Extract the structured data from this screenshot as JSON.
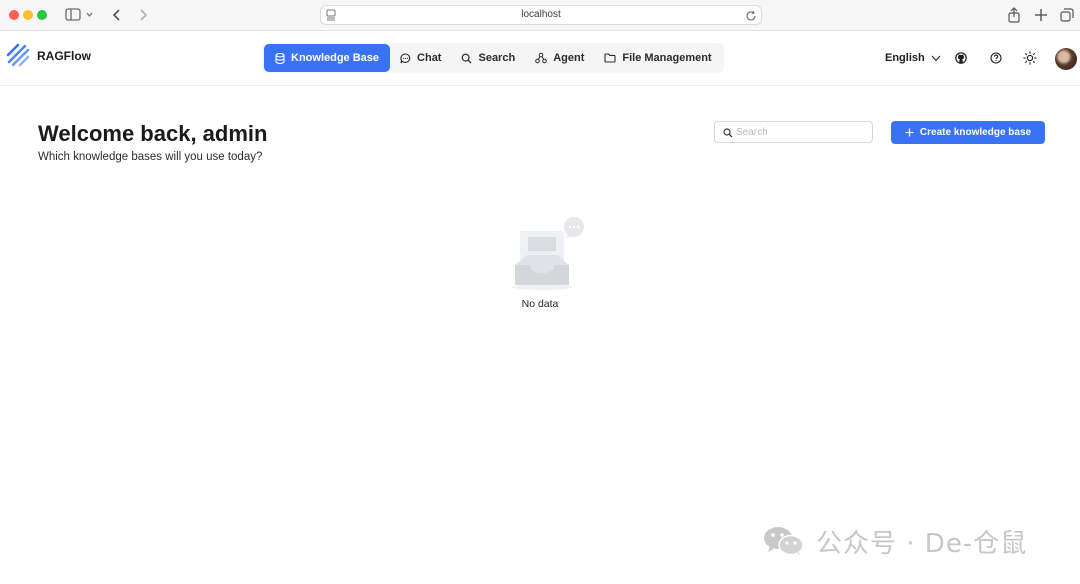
{
  "browser": {
    "url": "localhost"
  },
  "app": {
    "name": "RAGFlow"
  },
  "nav": {
    "items": [
      {
        "label": "Knowledge Base",
        "icon": "database-icon",
        "active": true
      },
      {
        "label": "Chat",
        "icon": "chat-bubble-icon",
        "active": false
      },
      {
        "label": "Search",
        "icon": "search-icon",
        "active": false
      },
      {
        "label": "Agent",
        "icon": "agent-nodes-icon",
        "active": false
      },
      {
        "label": "File Management",
        "icon": "folder-icon",
        "active": false
      }
    ]
  },
  "header": {
    "language": "English"
  },
  "main": {
    "welcome": "Welcome back, admin",
    "subtitle": "Which knowledge bases will you use today?",
    "search_placeholder": "Search",
    "create_label": "Create knowledge base",
    "empty_text": "No data"
  },
  "watermark": {
    "text": "公众号 · De-仓鼠"
  },
  "colors": {
    "accent": "#3a72f5",
    "border": "#d6d6d6",
    "watermark": "#c7c7c7"
  }
}
